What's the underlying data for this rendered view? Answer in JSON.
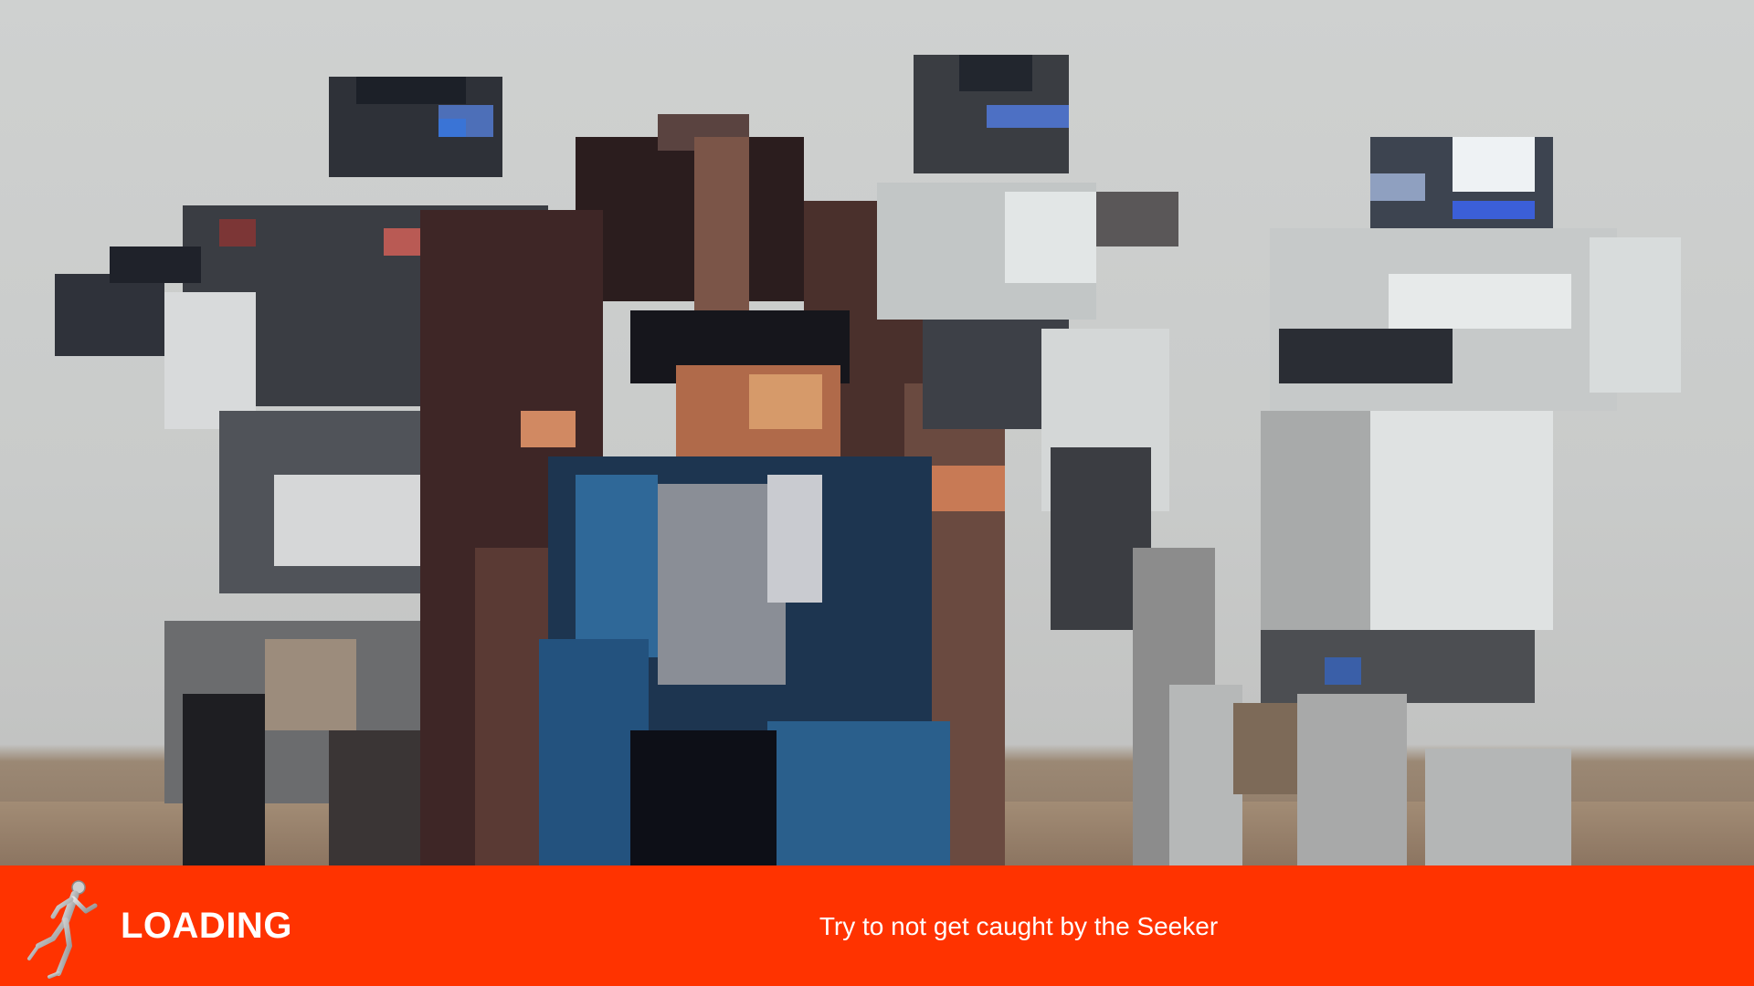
{
  "loading_screen": {
    "title": "LOADING",
    "tip": "Try to not get caught by the Seeker",
    "icon": "running-mannequin-icon",
    "accent_color": "#ff3300",
    "text_color": "#ffffff"
  },
  "background": {
    "style": "pixelated",
    "floor_color": "#9b8470",
    "wall_color": "#cfd1d0"
  }
}
